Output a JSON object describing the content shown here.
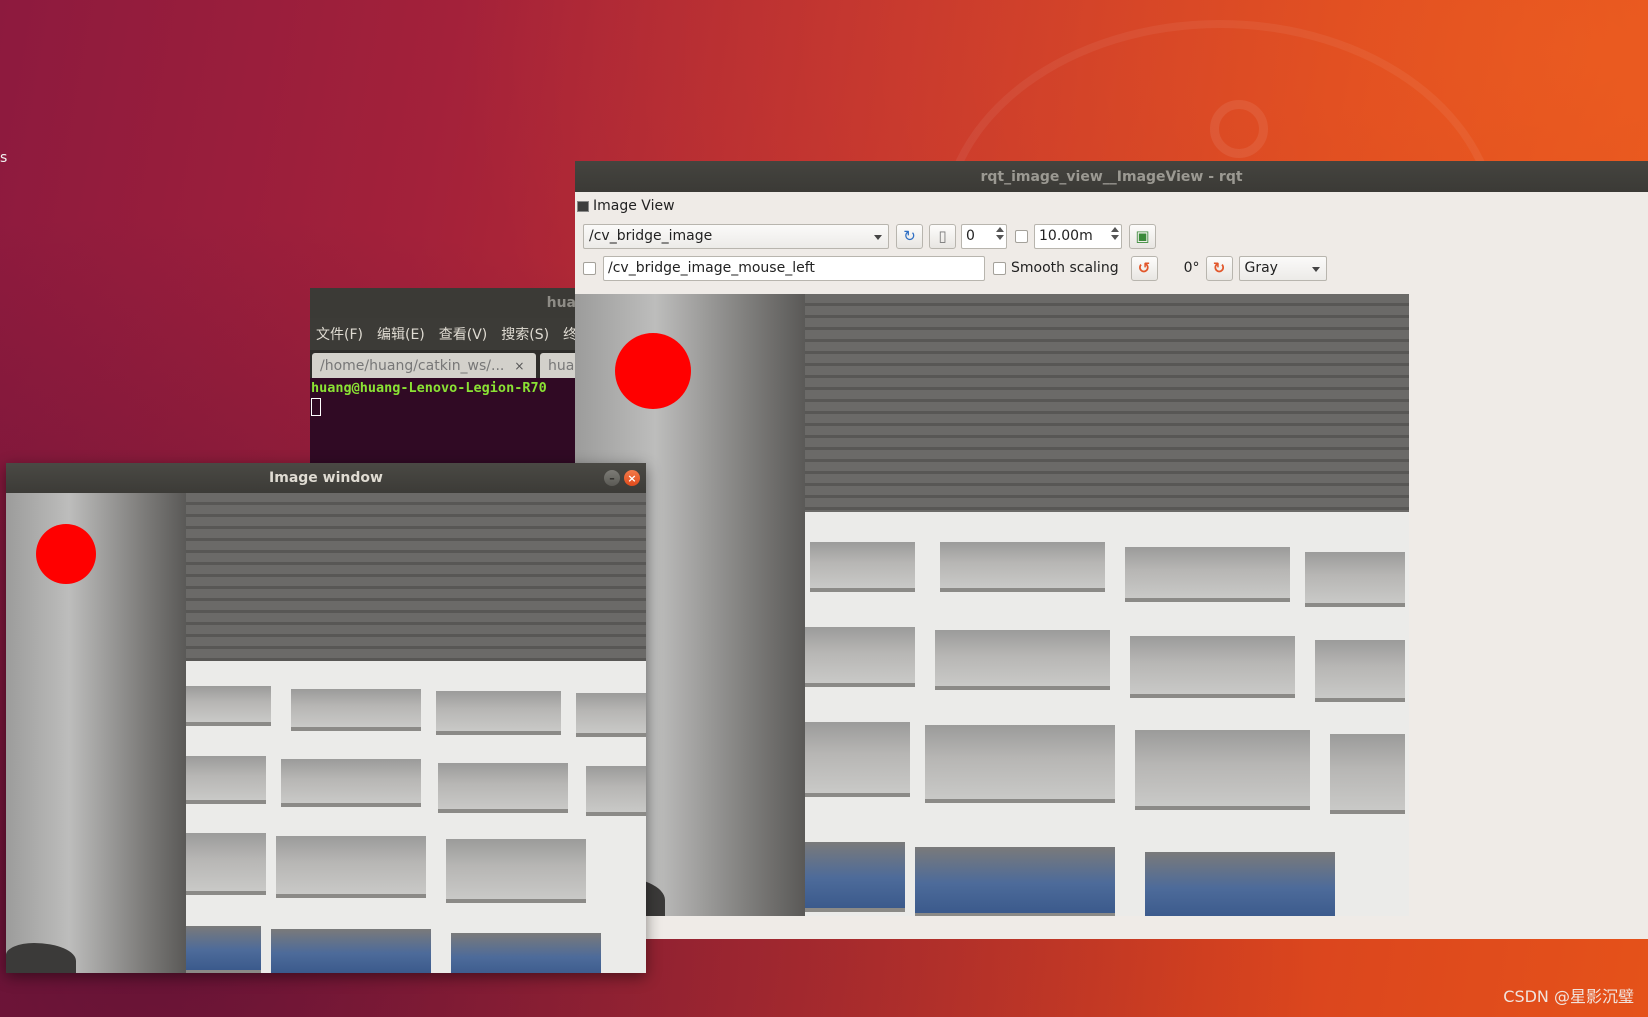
{
  "desktop": {
    "watermark": "CSDN @星影沉璧",
    "edge_glyph": "s"
  },
  "terminal": {
    "title": "huang@",
    "menu": [
      "文件(F)",
      "编辑(E)",
      "查看(V)",
      "搜索(S)",
      "终"
    ],
    "tabs": [
      {
        "label": "/home/huang/catkin_ws/...",
        "close": "×"
      },
      {
        "label": "huan"
      }
    ],
    "prompt": "huang@huang-Lenovo-Legion-R70"
  },
  "rqt": {
    "title": "rqt_image_view__ImageView - rqt",
    "dock_title": "Image View",
    "topic": "/cv_bridge_image",
    "spin_value": "0",
    "max_age": "10.00m",
    "mouse_topic": "/cv_bridge_image_mouse_left",
    "smooth_scaling_label": "Smooth scaling",
    "rotation": "0°",
    "color_scheme": "Gray"
  },
  "image_window": {
    "title": "Image window",
    "minimize": "–",
    "close": "×"
  },
  "icons": {
    "refresh": "refresh-icon",
    "zoom": "zoom-icon",
    "save": "save-image-icon",
    "rotate_left": "rotate-left-icon",
    "rotate_right": "rotate-right-icon"
  },
  "colors": {
    "marker": "#ff0000",
    "terminal_prompt": "#8ae234",
    "close_button": "#e8562a"
  }
}
